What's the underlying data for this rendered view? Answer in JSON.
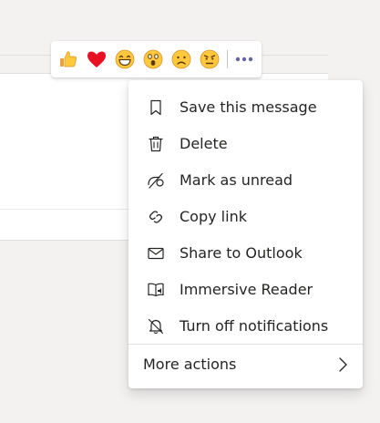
{
  "reactions": [
    {
      "name": "like",
      "icon": "thumbs-up-icon"
    },
    {
      "name": "heart",
      "icon": "heart-icon"
    },
    {
      "name": "laugh",
      "icon": "laughing-face-icon"
    },
    {
      "name": "surprised",
      "icon": "surprised-face-icon"
    },
    {
      "name": "sad",
      "icon": "sad-face-icon"
    },
    {
      "name": "angry",
      "icon": "angry-face-icon"
    }
  ],
  "more_options_icon": "ellipsis-icon",
  "menu": {
    "items": [
      {
        "label": "Save this message",
        "icon": "bookmark-icon"
      },
      {
        "label": "Delete",
        "icon": "trash-icon"
      },
      {
        "label": "Mark as unread",
        "icon": "mark-unread-icon"
      },
      {
        "label": "Copy link",
        "icon": "link-icon"
      },
      {
        "label": "Share to Outlook",
        "icon": "mail-icon"
      },
      {
        "label": "Immersive Reader",
        "icon": "immersive-reader-icon"
      },
      {
        "label": "Turn off notifications",
        "icon": "bell-off-icon"
      }
    ],
    "more_actions": {
      "label": "More actions",
      "icon": "chevron-right-icon"
    }
  },
  "colors": {
    "accent": "#6264a7",
    "background": "#f3f2f1",
    "surface": "#ffffff",
    "text": "#252423",
    "heart": "#e81123",
    "emoji_yellow": "#ffc83d"
  }
}
